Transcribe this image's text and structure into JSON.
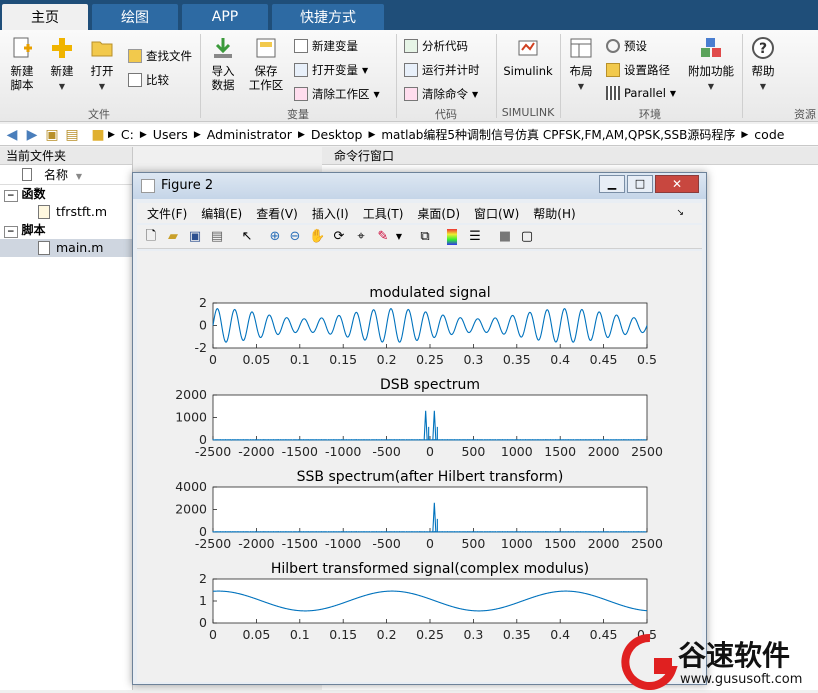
{
  "tabs": [
    {
      "label": "主页",
      "active": true
    },
    {
      "label": "绘图",
      "active": false
    },
    {
      "label": "APP",
      "active": false
    },
    {
      "label": "快捷方式",
      "active": false
    }
  ],
  "ribbon": {
    "file": {
      "new_script": "新建\n脚本",
      "new": "新建",
      "open": "打开",
      "find_files": "查找文件",
      "compare": "比较",
      "label": "文件"
    },
    "variable": {
      "import": "导入\n数据",
      "save_ws": "保存\n工作区",
      "new_var": "新建变量",
      "open_var": "打开变量",
      "clear_ws": "清除工作区",
      "label": "变量"
    },
    "code": {
      "analyze": "分析代码",
      "run_time": "运行并计时",
      "clear_cmd": "清除命令",
      "label": "代码"
    },
    "simulink": {
      "btn": "Simulink",
      "label": "SIMULINK"
    },
    "env": {
      "layout": "布局",
      "prefs": "预设",
      "set_path": "设置路径",
      "parallel": "Parallel",
      "addons": "附加功能",
      "label": "环境"
    },
    "resources": {
      "help": "帮助",
      "label": "资源"
    }
  },
  "address": {
    "crumbs": [
      "C:",
      "Users",
      "Administrator",
      "Desktop",
      "matlab编程5种调制信号仿真 CPFSK,FM,AM,QPSK,SSB源码程序",
      "code"
    ]
  },
  "left_panel": {
    "title": "当前文件夹",
    "col_name": "名称",
    "groups": [
      {
        "header": "函数",
        "items": [
          "tfrstft.m"
        ]
      },
      {
        "header": "脚本",
        "items": [
          "main.m"
        ]
      }
    ]
  },
  "right_panel": {
    "title": "命令行窗口"
  },
  "figure": {
    "title": "Figure 2",
    "menu": [
      "文件(F)",
      "编辑(E)",
      "查看(V)",
      "插入(I)",
      "工具(T)",
      "桌面(D)",
      "窗口(W)",
      "帮助(H)"
    ]
  },
  "chart_data": [
    {
      "type": "line",
      "title": "modulated signal",
      "xlim": [
        0,
        0.5
      ],
      "ylim": [
        -2,
        2
      ],
      "xticks": [
        "0",
        "0.05",
        "0.1",
        "0.15",
        "0.2",
        "0.25",
        "0.3",
        "0.35",
        "0.4",
        "0.45",
        "0.5"
      ],
      "yticks": [
        "-2",
        "0",
        "2"
      ]
    },
    {
      "type": "line",
      "title": "DSB spectrum",
      "xlim": [
        -2500,
        2500
      ],
      "ylim": [
        0,
        2000
      ],
      "xticks": [
        "-2500",
        "-2000",
        "-1500",
        "-1000",
        "-500",
        "0",
        "500",
        "1000",
        "1500",
        "2000",
        "2500"
      ],
      "yticks": [
        "0",
        "1000",
        "2000"
      ],
      "peaks": [
        {
          "x": -50,
          "y": 1300
        },
        {
          "x": 50,
          "y": 1300
        }
      ]
    },
    {
      "type": "line",
      "title": "SSB spectrum(after Hilbert transform)",
      "xlim": [
        -2500,
        2500
      ],
      "ylim": [
        0,
        4000
      ],
      "xticks": [
        "-2500",
        "-2000",
        "-1500",
        "-1000",
        "-500",
        "0",
        "500",
        "1000",
        "1500",
        "2000",
        "2500"
      ],
      "yticks": [
        "0",
        "2000",
        "4000"
      ],
      "peaks": [
        {
          "x": 50,
          "y": 2600
        }
      ]
    },
    {
      "type": "line",
      "title": "Hilbert transformed signal(complex modulus)",
      "xlim": [
        0,
        0.5
      ],
      "ylim": [
        0,
        2
      ],
      "xticks": [
        "0",
        "0.05",
        "0.1",
        "0.15",
        "0.2",
        "0.25",
        "0.3",
        "0.35",
        "0.4",
        "0.45",
        "0.5"
      ],
      "yticks": [
        "0",
        "1",
        "2"
      ]
    }
  ],
  "watermark": {
    "name": "谷速软件",
    "url": "www.gususoft.com"
  },
  "colors": {
    "line": "#0072bd",
    "tab_bg": "#1f4e79",
    "accent": "#e02020"
  }
}
